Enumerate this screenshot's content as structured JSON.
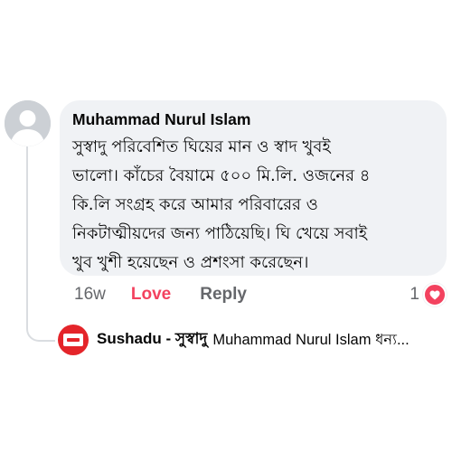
{
  "comment": {
    "author": "Muhammad Nurul Islam",
    "text": "সুস্বাদু পরিবেশিত ঘিয়ের মান ও স্বাদ খুবই\nভালো। কাঁচের বৈয়ামে ৫০০ মি.লি. ওজনের ৪\nকি.লি সংগ্রহ করে আমার পরিবারের ও\nনিকটাত্মীয়দের জন্য পাঠিয়েছি। ঘি খেয়ে সবাই\nখুব খুশী হয়েছেন ও প্রশংসা করেছেন।",
    "time": "16w",
    "like_label": "Love",
    "reply_label": "Reply",
    "reaction_count": "1",
    "reaction_icon": "heart-icon"
  },
  "reply": {
    "author_prefix": "Sushadu - ",
    "author_bn": "সুস্বাদু",
    "preview": "Muhammad Nurul Islam  ধন্য..."
  },
  "colors": {
    "love": "#f3425f",
    "bubble_bg": "#f0f2f5",
    "meta_text": "#65676b",
    "page_avatar": "#e4252a"
  }
}
